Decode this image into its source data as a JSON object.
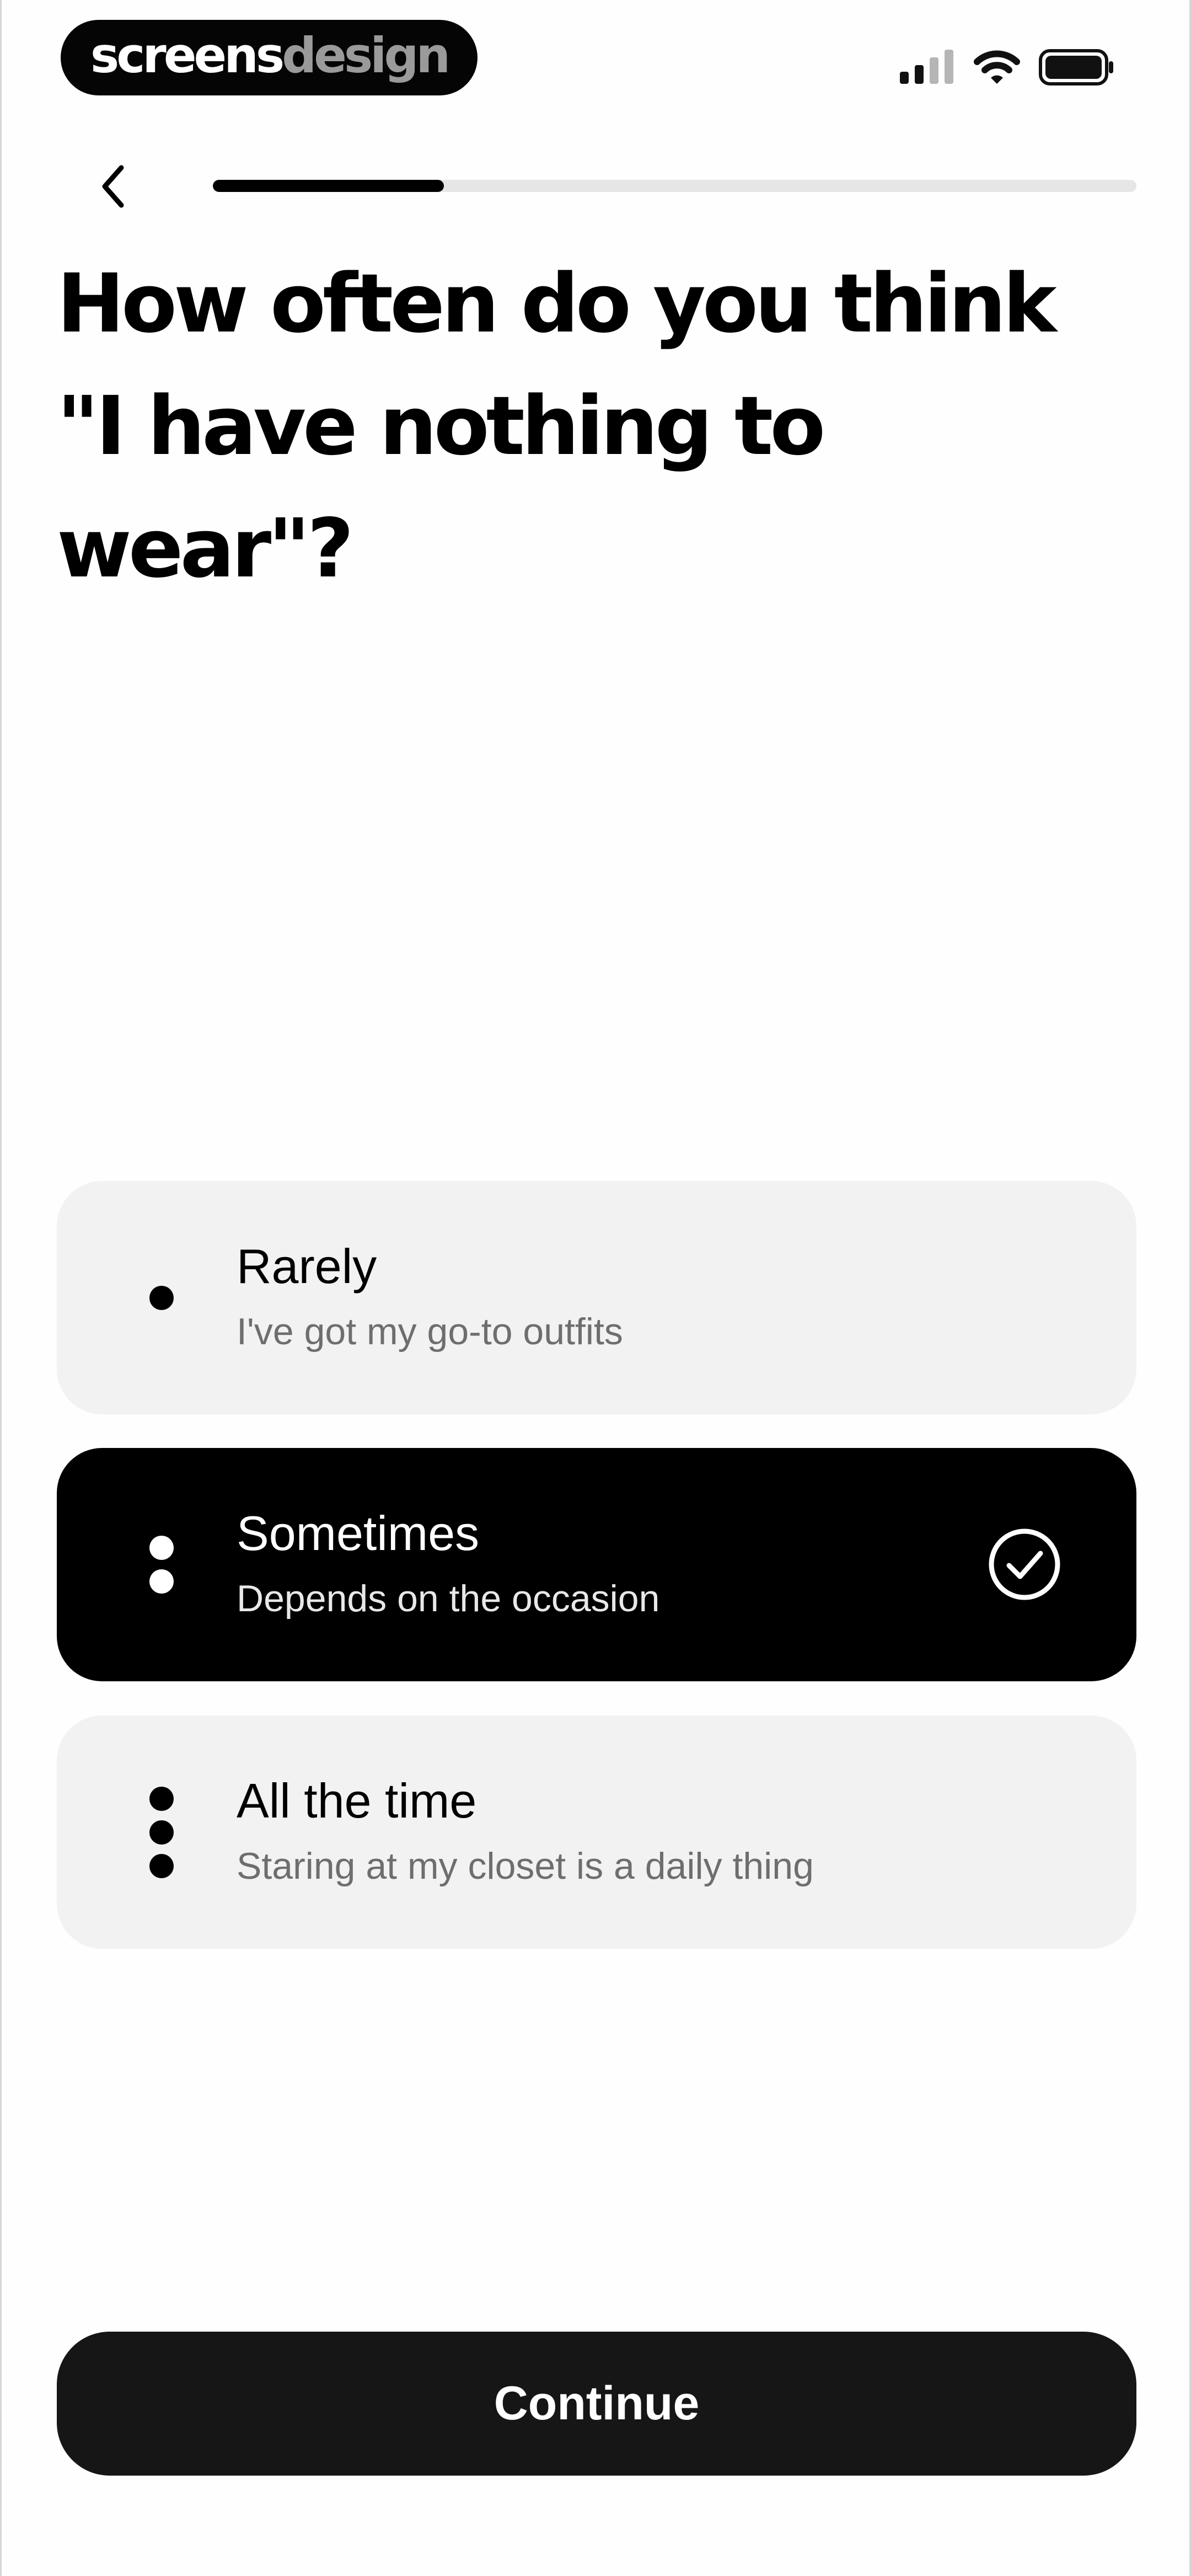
{
  "brand": {
    "part1": "screens",
    "part2": "design"
  },
  "status_bar": {
    "icons": [
      "cellular-signal-icon",
      "wifi-icon",
      "battery-icon"
    ]
  },
  "nav": {
    "back_icon": "chevron-left-icon",
    "progress": 0.25
  },
  "question": "How often do you think \"I have nothing to wear\"?",
  "options": [
    {
      "title": "Rarely",
      "subtitle": "I've got my go-to outfits",
      "dots": 1,
      "selected": false
    },
    {
      "title": "Sometimes",
      "subtitle": "Depends on the occasion",
      "dots": 2,
      "selected": true
    },
    {
      "title": "All the time",
      "subtitle": "Staring at my closet is a daily thing",
      "dots": 3,
      "selected": false
    }
  ],
  "continue_label": "Continue",
  "colors": {
    "selected_bg": "#000000",
    "option_bg": "#f2f2f2",
    "button_bg": "#161616",
    "track": "#e6e6e6"
  }
}
